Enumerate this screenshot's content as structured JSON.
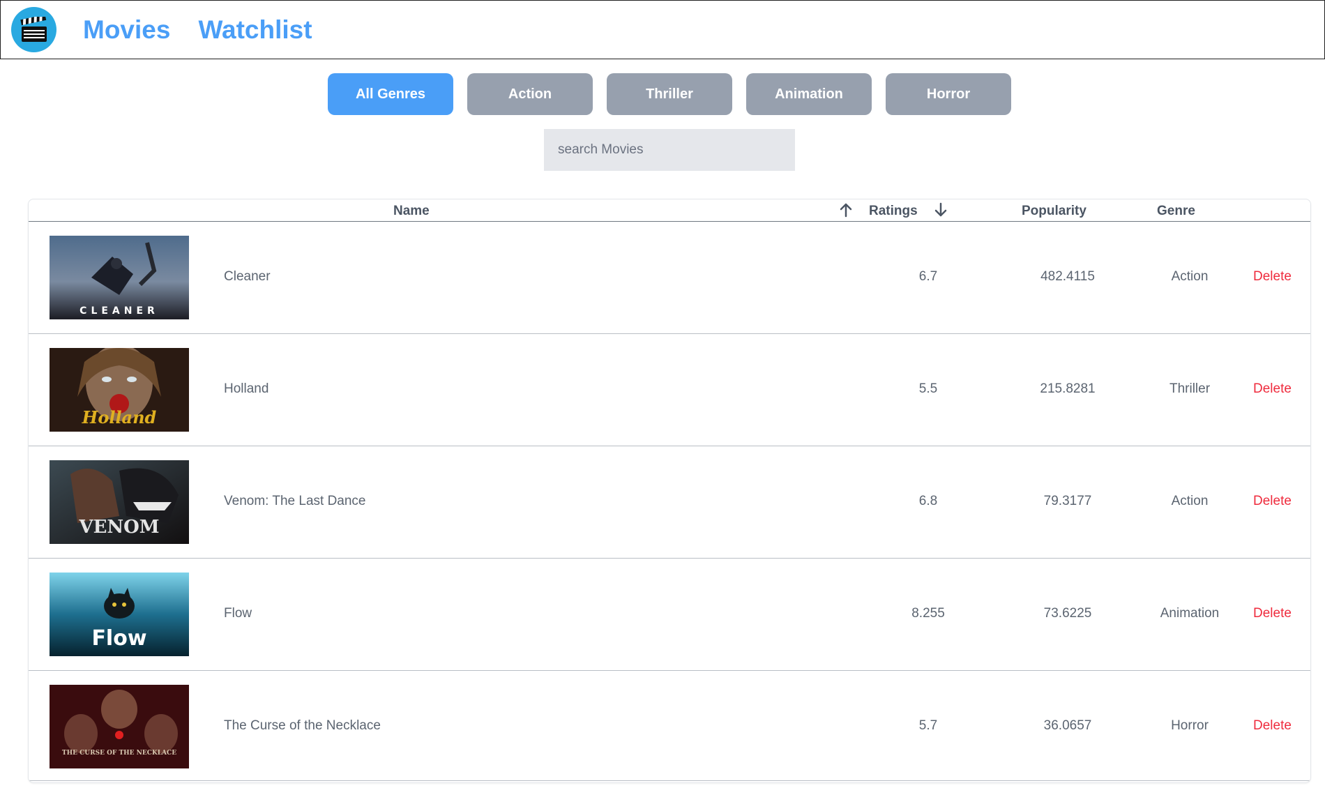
{
  "nav": {
    "logo_icon": "clapperboard-icon",
    "movies_label": "Movies",
    "watchlist_label": "Watchlist",
    "accent_color": "#4a9ef7"
  },
  "genres": {
    "selected": "All Genres",
    "items": [
      "All Genres",
      "Action",
      "Thriller",
      "Animation",
      "Horror"
    ]
  },
  "search": {
    "placeholder": "search Movies",
    "value": ""
  },
  "table": {
    "headers": {
      "name": "Name",
      "ratings": "Ratings",
      "popularity": "Popularity",
      "genre": "Genre"
    },
    "sort_icons": [
      "arrow-up-icon",
      "arrow-down-icon"
    ],
    "delete_label": "Delete",
    "delete_color": "#ef2b3d",
    "rows": [
      {
        "name": "Cleaner",
        "rating": "6.7",
        "popularity": "482.4115",
        "genre": "Action",
        "poster_title": "CLEANER"
      },
      {
        "name": "Holland",
        "rating": "5.5",
        "popularity": "215.8281",
        "genre": "Thriller",
        "poster_title": "Holland"
      },
      {
        "name": "Venom: The Last Dance",
        "rating": "6.8",
        "popularity": "79.3177",
        "genre": "Action",
        "poster_title": "VENOM"
      },
      {
        "name": "Flow",
        "rating": "8.255",
        "popularity": "73.6225",
        "genre": "Animation",
        "poster_title": "Flow"
      },
      {
        "name": "The Curse of the Necklace",
        "rating": "5.7",
        "popularity": "36.0657",
        "genre": "Horror",
        "poster_title": "THE CURSE OF THE NECKLACE"
      }
    ]
  }
}
